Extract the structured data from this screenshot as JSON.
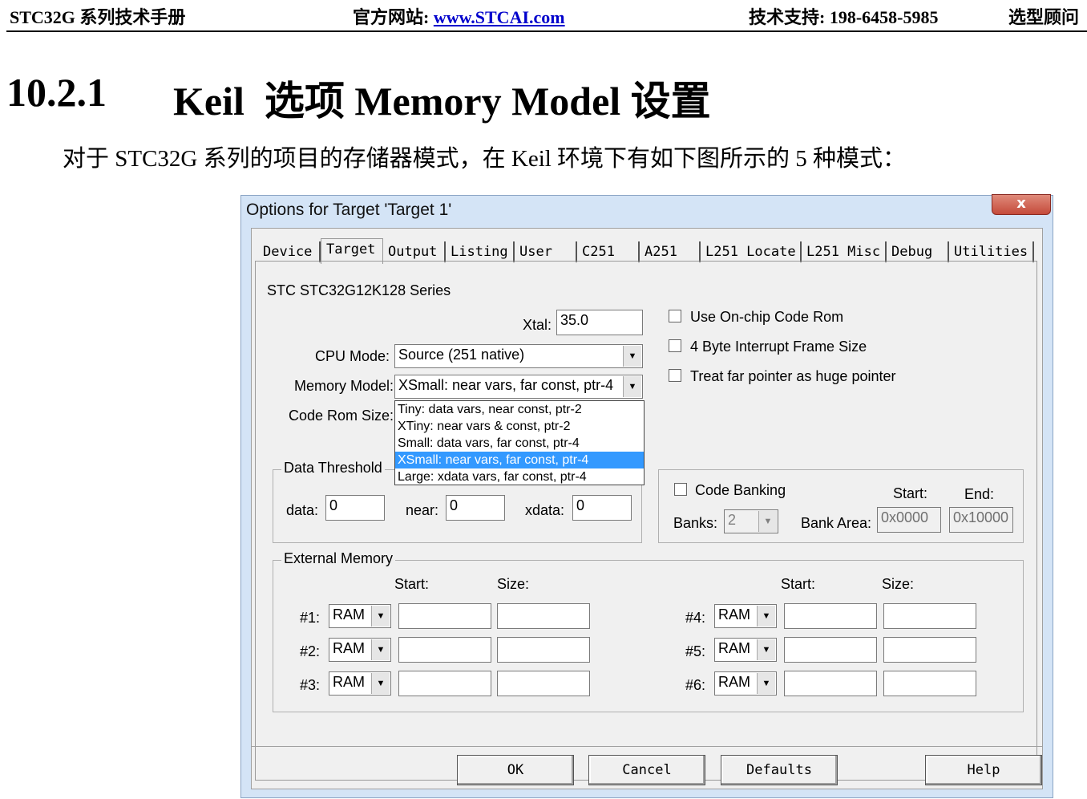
{
  "header": {
    "manual": "STC32G 系列技术手册",
    "site_label": "官方网站: ",
    "site_url": "www.STCAI.com",
    "support": "技术支持: 198-6458-5985",
    "selection": "选型顾问"
  },
  "section": {
    "number": "10.2.1",
    "title": "Keil  选项 Memory Model 设置"
  },
  "body_text": "对于 STC32G 系列的项目的存储器模式，在 Keil 环境下有如下图所示的 5 种模式：",
  "dialog": {
    "title": "Options for Target 'Target 1'",
    "close": "x",
    "tabs": [
      "Device",
      "Target",
      "Output",
      "Listing",
      "User",
      "C251",
      "A251",
      "L251 Locate",
      "L251 Misc",
      "Debug",
      "Utilities"
    ],
    "active_tab": "Target",
    "device_name": "STC STC32G12K128 Series",
    "xtal_label": "Xtal:",
    "xtal_value": "35.0",
    "cpu_mode_label": "CPU Mode:",
    "cpu_mode_value": "Source (251 native)",
    "memory_model_label": "Memory Model:",
    "memory_model_value": "XSmall: near vars, far const, ptr-4",
    "code_rom_size_label": "Code Rom Size:",
    "memory_model_options": [
      "Tiny: data vars, near const, ptr-2",
      "XTiny: near vars & const, ptr-2",
      "Small: data vars, far const, ptr-4",
      "XSmall: near vars, far const, ptr-4",
      "Large: xdata vars, far const, ptr-4"
    ],
    "selected_option_index": 3,
    "checkboxes": [
      {
        "label": "Use On-chip Code Rom",
        "checked": false
      },
      {
        "label": "4 Byte Interrupt Frame Size",
        "checked": false
      },
      {
        "label": "Treat far pointer as huge pointer",
        "checked": false
      }
    ],
    "data_threshold": {
      "title": "Data Threshold",
      "data_label": "data:",
      "data_value": "0",
      "near_label": "near:",
      "near_value": "0",
      "xdata_label": "xdata:",
      "xdata_value": "0"
    },
    "code_banking": {
      "label": "Code Banking",
      "checked": false,
      "start_label": "Start:",
      "end_label": "End:",
      "banks_label": "Banks:",
      "banks_value": "2",
      "bank_area_label": "Bank Area:",
      "start_value": "0x0000",
      "end_value": "0x10000"
    },
    "external_memory": {
      "title": "External Memory",
      "start_label": "Start:",
      "size_label": "Size:",
      "rows": [
        {
          "label": "#1:",
          "type": "RAM",
          "start": "",
          "size": ""
        },
        {
          "label": "#2:",
          "type": "RAM",
          "start": "",
          "size": ""
        },
        {
          "label": "#3:",
          "type": "RAM",
          "start": "",
          "size": ""
        },
        {
          "label": "#4:",
          "type": "RAM",
          "start": "",
          "size": ""
        },
        {
          "label": "#5:",
          "type": "RAM",
          "start": "",
          "size": ""
        },
        {
          "label": "#6:",
          "type": "RAM",
          "start": "",
          "size": ""
        }
      ]
    },
    "buttons": {
      "ok": "OK",
      "cancel": "Cancel",
      "defaults": "Defaults",
      "help": "Help"
    }
  }
}
